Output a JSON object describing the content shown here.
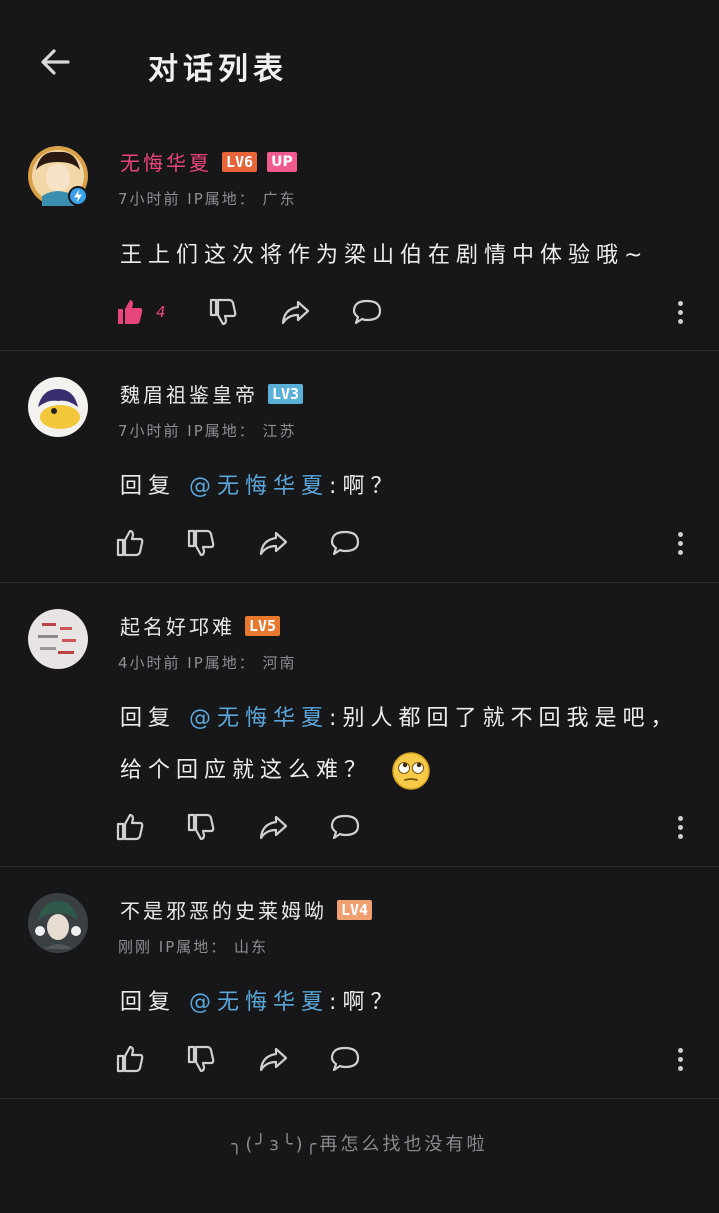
{
  "header": {
    "title": "对话列表"
  },
  "comments": [
    {
      "username": "无悔华夏",
      "level": "LV6",
      "level_color": "#e8643a",
      "up_badge": "UP",
      "verified": true,
      "meta": "7小时前  IP属地：  广东",
      "content": "王上们这次将作为梁山伯在剧情中体验哦~",
      "likes": "4",
      "liked": true
    },
    {
      "username": "魏眉祖鉴皇帝",
      "level": "LV3",
      "level_color": "#5bb0d8",
      "meta": "7小时前  IP属地：  江苏",
      "reply_prefix": "回复",
      "mention": "@无悔华夏",
      "content": ":啊？"
    },
    {
      "username": "起名好邛难",
      "level": "LV5",
      "level_color": "#e8782e",
      "meta": "4小时前  IP属地：  河南",
      "reply_prefix": "回复",
      "mention": "@无悔华夏",
      "content": ":别人都回了就不回我是吧，",
      "content_line2": "给个回应就这么难？",
      "emoji": "rolling-eyes-emoji"
    },
    {
      "username": "不是邪恶的史莱姆呦",
      "level": "LV4",
      "level_color": "#f0a070",
      "meta": "刚刚  IP属地：  山东",
      "reply_prefix": "回复",
      "mention": "@无悔华夏",
      "content": ":啊？"
    }
  ],
  "footer": {
    "text": "╮(╯з╰)╭再怎么找也没有啦"
  },
  "colors": {
    "background": "#17171a",
    "accent_pink": "#e8457a",
    "mention_blue": "#5ba6d8"
  }
}
